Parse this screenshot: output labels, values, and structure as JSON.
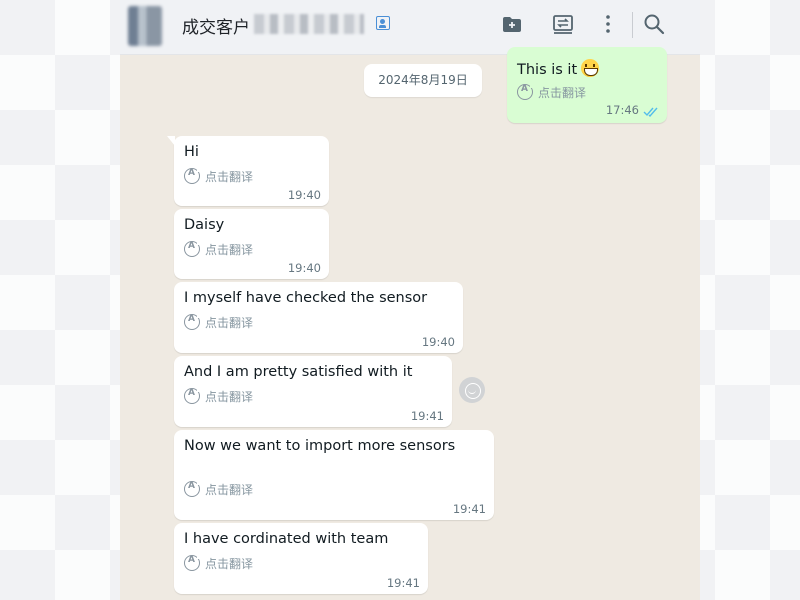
{
  "header": {
    "contact_name": "成交客户"
  },
  "chat": {
    "date_separator": "2024年8月19日",
    "translate_label": "点击翻译",
    "outgoing": {
      "text": "This is it",
      "time": "17:46"
    },
    "messages": [
      {
        "text": "Hi",
        "time": "19:40"
      },
      {
        "text": "Daisy",
        "time": "19:40"
      },
      {
        "text": "I myself have checked the sensor",
        "time": "19:40"
      },
      {
        "text": "And I am pretty satisfied with it",
        "time": "19:41"
      },
      {
        "text": "Now we want to import more sensors",
        "time": "19:41"
      },
      {
        "text": "I have cordinated with team",
        "time": "19:41"
      }
    ]
  },
  "icons": {
    "header": [
      "add-chat-icon",
      "summary-icon",
      "more-vert-icon",
      "search-icon"
    ],
    "read_receipt": "double-check-icon",
    "reaction": "emoji-reaction-icon"
  },
  "colors": {
    "outgoing_bubble": "#d9fdd3",
    "incoming_bubble": "#ffffff",
    "chat_background": "#efeae2",
    "read_tick": "#53bdeb"
  }
}
